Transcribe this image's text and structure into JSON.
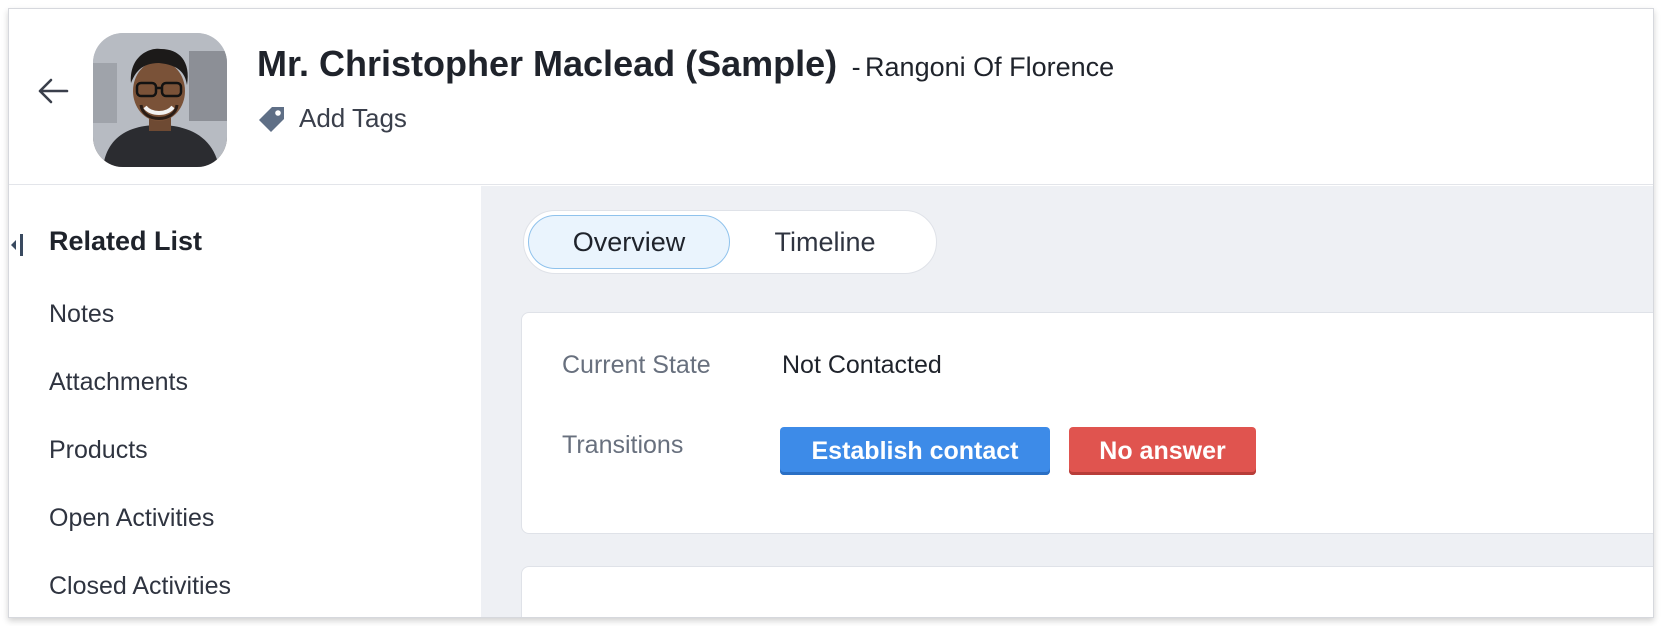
{
  "header": {
    "contact_name": "Mr. Christopher Maclead (Sample)",
    "account_separator": "-",
    "account_name": "Rangoni Of Florence",
    "add_tags_label": "Add Tags"
  },
  "sidebar": {
    "title": "Related List",
    "items": [
      {
        "label": "Notes"
      },
      {
        "label": "Attachments"
      },
      {
        "label": "Products"
      },
      {
        "label": "Open Activities"
      },
      {
        "label": "Closed Activities"
      }
    ]
  },
  "main": {
    "tabs": [
      {
        "label": "Overview",
        "active": true
      },
      {
        "label": "Timeline",
        "active": false
      }
    ],
    "state_card": {
      "current_state_label": "Current State",
      "current_state_value": "Not Contacted",
      "transitions_label": "Transitions",
      "transitions": [
        {
          "label": "Establish contact",
          "color": "#3d8be8"
        },
        {
          "label": "No answer",
          "color": "#e0544f"
        }
      ]
    }
  },
  "icons": {
    "back": "arrow-left-icon",
    "tag": "tag-icon",
    "collapse": "collapse-sidebar-icon"
  }
}
